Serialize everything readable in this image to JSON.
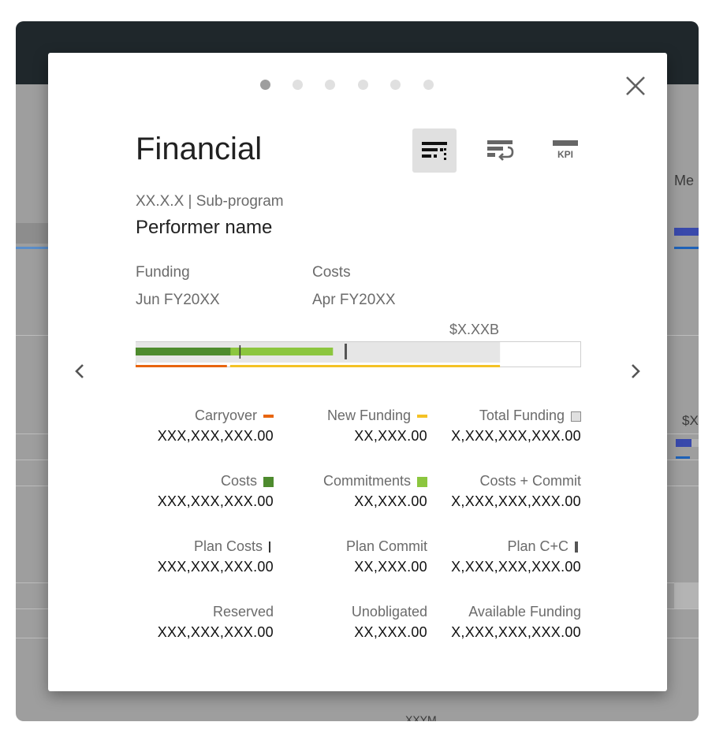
{
  "background": {
    "partial_texts": {
      "header_fragment": "Me",
      "value_fragment": "$X",
      "footer_fragment": "XXYM"
    }
  },
  "modal": {
    "pager": {
      "count": 6,
      "active_index": 0
    },
    "title": "Financial",
    "view_icons": [
      "financial-view-icon",
      "transfer-view-icon",
      "kpi-view-icon"
    ],
    "kpi_icon_text": "KPI",
    "subprogram": "XX.X.X | Sub-program",
    "performer": "Performer name",
    "funding_label": "Funding",
    "funding_date": "Jun FY20XX",
    "costs_label": "Costs",
    "costs_date": "Apr FY20XX",
    "total_label": "$X.XXB",
    "bar": {
      "costs_fraction": 0.213,
      "commitments_fraction": 0.443,
      "plan_costs_fraction": 0.233,
      "plan_cc_fraction": 0.469,
      "total_funding_fraction": 0.818,
      "carryover_fraction": 0.205,
      "new_funding_fraction": 0.605
    },
    "stats": [
      {
        "label": "Carryover",
        "value": "XXX,XXX,XXX.00",
        "swatch": "dash",
        "color": "#e8650f"
      },
      {
        "label": "New Funding",
        "value": "XX,XXX.00",
        "swatch": "dash",
        "color": "#f4c225"
      },
      {
        "label": "Total Funding",
        "value": "X,XXX,XXX,XXX.00",
        "swatch": "square-outline",
        "color": "#e0e0e0"
      },
      {
        "label": "Costs",
        "value": "XXX,XXX,XXX.00",
        "swatch": "square",
        "color": "#4e8b2e"
      },
      {
        "label": "Commitments",
        "value": "XX,XXX.00",
        "swatch": "square",
        "color": "#8cc63f"
      },
      {
        "label": "Costs + Commit",
        "value": "X,XXX,XXX,XXX.00",
        "swatch": "none",
        "color": ""
      },
      {
        "label": "Plan Costs",
        "value": "XXX,XXX,XXX.00",
        "swatch": "tick-thin",
        "color": "#333333"
      },
      {
        "label": "Plan Commit",
        "value": "XX,XXX.00",
        "swatch": "none",
        "color": ""
      },
      {
        "label": "Plan C+C",
        "value": "X,XXX,XXX,XXX.00",
        "swatch": "tick-thick",
        "color": "#555555"
      },
      {
        "label": "Reserved",
        "value": "XXX,XXX,XXX.00",
        "swatch": "none",
        "color": ""
      },
      {
        "label": "Unobligated",
        "value": "XX,XXX.00",
        "swatch": "none",
        "color": ""
      },
      {
        "label": "Available Funding",
        "value": "X,XXX,XXX,XXX.00",
        "swatch": "none",
        "color": ""
      }
    ]
  }
}
